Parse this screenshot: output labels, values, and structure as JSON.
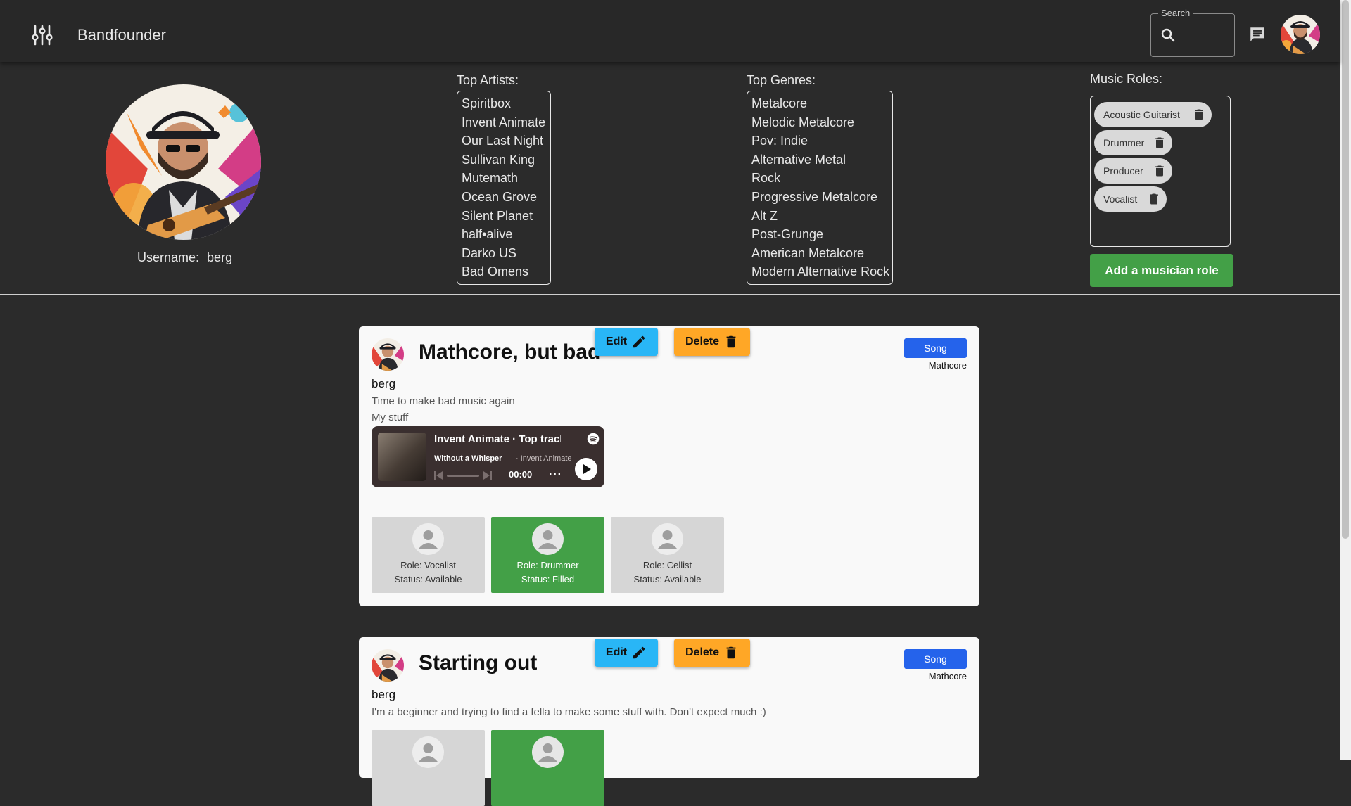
{
  "app": {
    "title": "Bandfounder"
  },
  "header": {
    "search_label": "Search",
    "search_value": ""
  },
  "profile": {
    "username_label": "Username:",
    "username": "berg",
    "top_artists_heading": "Top Artists:",
    "top_artists": [
      "Spiritbox",
      "Invent Animate",
      "Our Last Night",
      "Sullivan King",
      "Mutemath",
      "Ocean Grove",
      "Silent Planet",
      "half•alive",
      "Darko US",
      "Bad Omens"
    ],
    "top_genres_heading": "Top Genres:",
    "top_genres": [
      "Metalcore",
      "Melodic Metalcore",
      "Pov: Indie",
      "Alternative Metal",
      "Rock",
      "Progressive Metalcore",
      "Alt Z",
      "Post-Grunge",
      "American Metalcore",
      "Modern Alternative Rock"
    ],
    "music_roles_heading": "Music Roles:",
    "music_roles": [
      "Acoustic Guitarist",
      "Drummer",
      "Producer",
      "Vocalist"
    ],
    "add_role_label": "Add a musician role"
  },
  "posts": [
    {
      "title": "Mathcore, but bad",
      "author": "berg",
      "description": "Time to make bad music again",
      "subtitle": "My stuff",
      "type_badge": "Song",
      "genre": "Mathcore",
      "edit_label": "Edit",
      "delete_label": "Delete",
      "embed": {
        "title": "Invent Animate · Top tracks",
        "track": "Without a Whisper",
        "artist": "· Invent Animate",
        "time": "00:00"
      },
      "roles": [
        {
          "role": "Role: Vocalist",
          "status": "Status: Available",
          "filled": false
        },
        {
          "role": "Role: Drummer",
          "status": "Status: Filled",
          "filled": true
        },
        {
          "role": "Role: Cellist",
          "status": "Status: Available",
          "filled": false
        }
      ]
    },
    {
      "title": "Starting out",
      "author": "berg",
      "description": "I'm a beginner and trying to find a fella to make some stuff with. Don't expect much :)",
      "type_badge": "Song",
      "genre": "Mathcore",
      "edit_label": "Edit",
      "delete_label": "Delete",
      "roles": [
        {
          "filled": false
        },
        {
          "filled": true
        }
      ]
    }
  ],
  "colors": {
    "background": "#2b2b2b",
    "appbar": "#282828",
    "card": "#f9f9f9",
    "edit": "#29b6f6",
    "delete": "#ffa726",
    "song_badge": "#2563eb",
    "filled": "#43a047",
    "available": "#d6d6d6",
    "add_role": "#43a047"
  }
}
